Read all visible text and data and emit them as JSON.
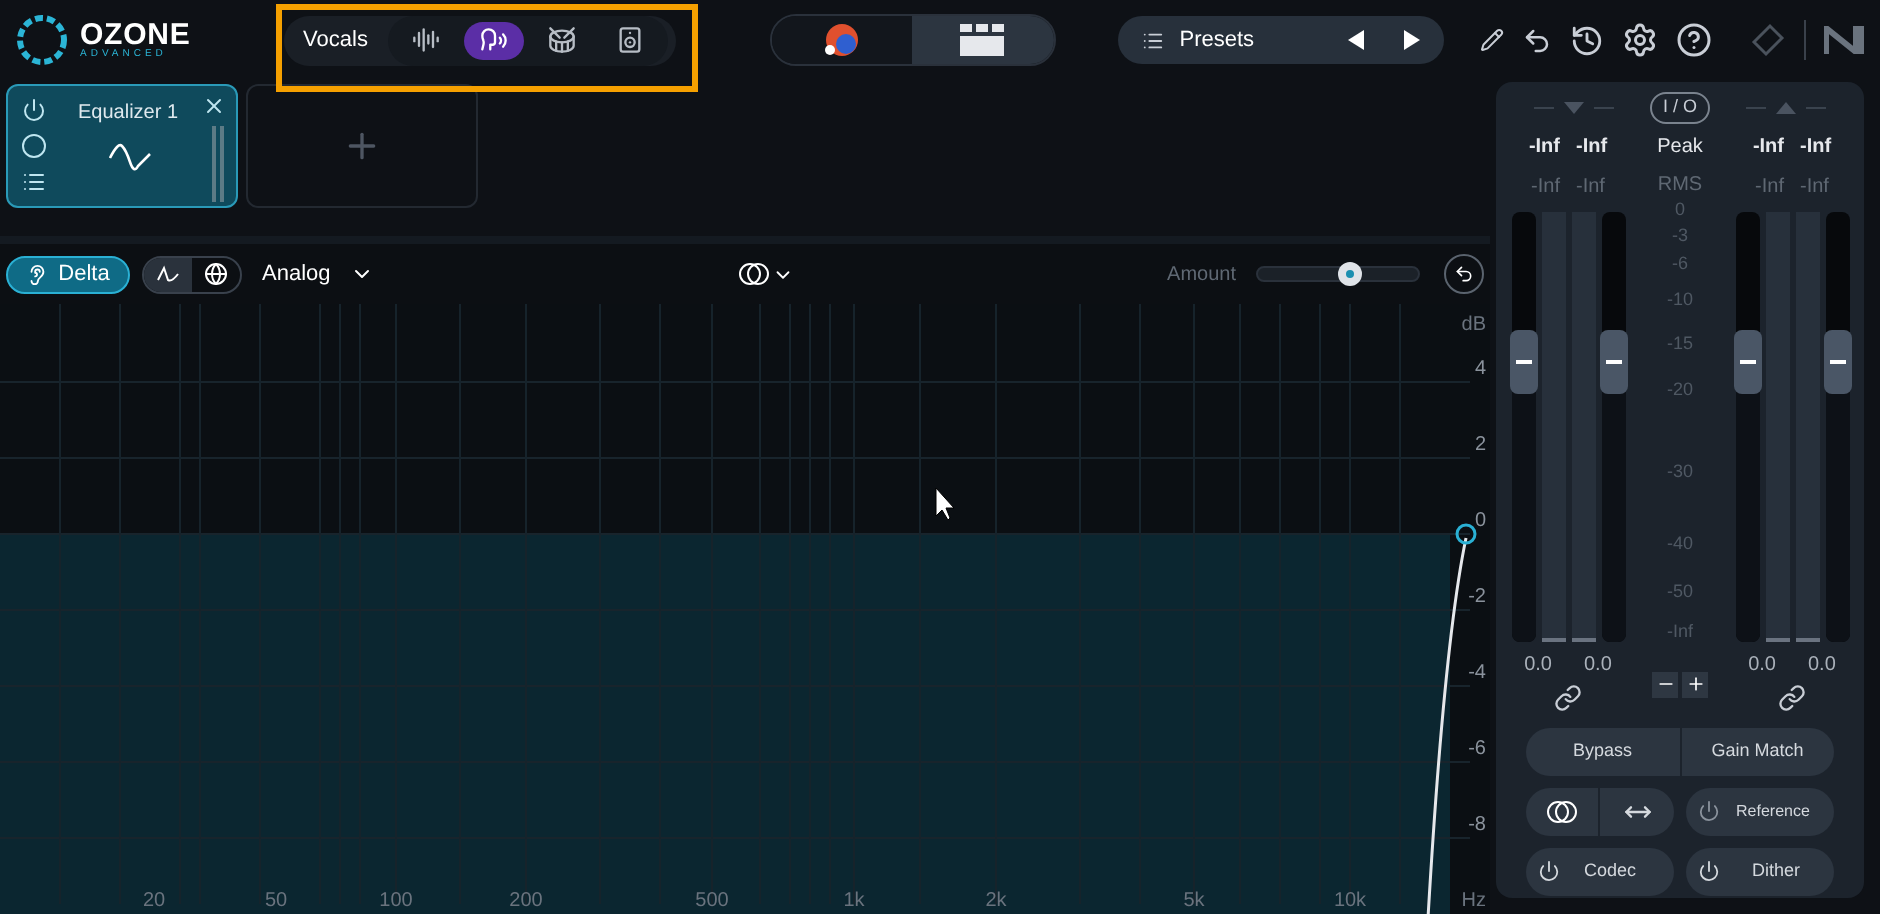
{
  "header": {
    "logo": {
      "name": "OZONE",
      "sub": "ADVANCED"
    },
    "assistant": {
      "label": "Vocals",
      "modes": [
        {
          "kind": "waveform",
          "selected": false
        },
        {
          "kind": "voice",
          "selected": true
        },
        {
          "kind": "drum",
          "selected": false
        },
        {
          "kind": "speaker",
          "selected": false
        }
      ]
    },
    "views": [
      {
        "kind": "orb",
        "selected": false
      },
      {
        "kind": "modules",
        "selected": true
      }
    ],
    "presets": {
      "label": "Presets"
    }
  },
  "modules": [
    {
      "name": "Equalizer 1",
      "selected": true
    }
  ],
  "eq_toolbar": {
    "delta": {
      "label": "Delta",
      "on": true
    },
    "graph_views": [
      {
        "kind": "curve",
        "selected": true
      },
      {
        "kind": "globe",
        "selected": false
      }
    ],
    "mode": "Analog",
    "amount": {
      "label": "Amount",
      "level": 0.58
    }
  },
  "eq_graph": {
    "db_unit": "dB",
    "db_labels": [
      "4",
      "2",
      "0",
      "-2",
      "-4",
      "-6",
      "-8"
    ],
    "hz_labels": [
      "20",
      "50",
      "100",
      "200",
      "500",
      "1k",
      "2k",
      "5k",
      "10k"
    ],
    "hz_unit": "Hz"
  },
  "meters": {
    "io": "I / O",
    "peak": "Peak",
    "rms": "RMS",
    "input": {
      "peak": [
        "-Inf",
        "-Inf"
      ],
      "rms": [
        "-Inf",
        "-Inf"
      ],
      "gain": [
        "0.0",
        "0.0"
      ]
    },
    "output": {
      "peak": [
        "-Inf",
        "-Inf"
      ],
      "rms": [
        "-Inf",
        "-Inf"
      ],
      "gain": [
        "0.0",
        "0.0"
      ]
    },
    "scale": [
      "0",
      "-3",
      "-6",
      "-10",
      "-15",
      "-20",
      "-30",
      "-40",
      "-50",
      "-Inf"
    ],
    "faders": [
      {
        "level": 0.65
      },
      {
        "level": 0.65
      },
      {
        "level": 0.65
      },
      {
        "level": 0.65
      }
    ]
  },
  "controls": {
    "bypass": "Bypass",
    "gain_match": "Gain Match",
    "reference": "Reference",
    "codec": "Codec",
    "dither": "Dither"
  }
}
